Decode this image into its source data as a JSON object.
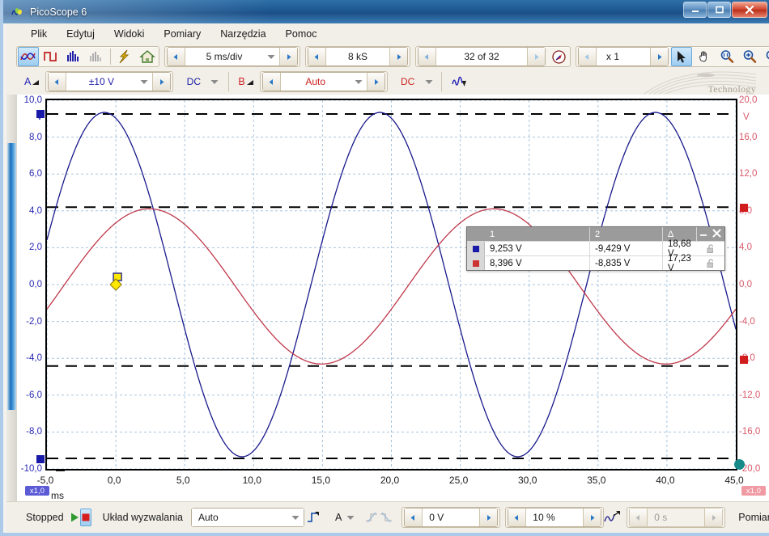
{
  "window": {
    "title": "PicoScope 6",
    "controls": {
      "minimize": "–",
      "maximize": "❐",
      "close": "✕"
    }
  },
  "menu": {
    "items": [
      {
        "label": "Plik"
      },
      {
        "label": "Edytuj"
      },
      {
        "label": "Widoki"
      },
      {
        "label": "Pomiary"
      },
      {
        "label": "Narzędzia"
      },
      {
        "label": "Pomoc"
      }
    ]
  },
  "toolbar_main": {
    "mode_icons": [
      {
        "name": "scope-mode-icon",
        "selected": true
      },
      {
        "name": "square-wave-icon",
        "selected": false
      },
      {
        "name": "spectrum-bars-icon",
        "selected": false
      },
      {
        "name": "spectrum-faded-icon",
        "selected": false
      }
    ],
    "action_icons": [
      {
        "name": "signal-generator-icon"
      },
      {
        "name": "home-icon"
      }
    ],
    "timebase": {
      "label": "timebase",
      "value": "5 ms/div"
    },
    "samples": {
      "label": "samples",
      "value": "8 kS"
    },
    "buffer": {
      "label": "buffer-navigator",
      "value": "32 of 32"
    },
    "compass_icon": "compass-icon",
    "zoom_factor": {
      "label": "zoom-factor",
      "value": "x 1"
    },
    "tools": [
      {
        "name": "pointer-tool-icon",
        "selected": true
      },
      {
        "name": "hand-pan-icon",
        "selected": false
      },
      {
        "name": "zoom-selection-icon",
        "selected": false
      },
      {
        "name": "zoom-in-icon",
        "selected": false
      },
      {
        "name": "zoom-out-icon",
        "selected": false
      },
      {
        "name": "undo-zoom-icon",
        "selected": false
      },
      {
        "name": "zoom-100-icon",
        "selected": false
      }
    ]
  },
  "toolbar_channels": {
    "channel_a": {
      "label": "A",
      "range": "±10 V",
      "coupling": "DC",
      "color": "#2a2ab5"
    },
    "channel_b": {
      "label": "B",
      "range": "Auto",
      "coupling": "DC",
      "color": "#cc2222"
    },
    "math_icon": "math-channel-icon"
  },
  "branding": {
    "tagline": "Technology"
  },
  "chart_data": {
    "type": "line",
    "title": "",
    "xlabel": "ms",
    "ylabel": "V",
    "xlim": [
      -5.0,
      45.0
    ],
    "xticks": [
      "-5,0",
      "0,0",
      "5,0",
      "10,0",
      "15,0",
      "20,0",
      "25,0",
      "30,0",
      "35,0",
      "40,0",
      "45,0"
    ],
    "xtick_values": [
      -5,
      0,
      5,
      10,
      15,
      20,
      25,
      30,
      35,
      40,
      45
    ],
    "left_axis": {
      "unit": "V",
      "color": "#2a2ab5",
      "ylim": [
        -10.0,
        10.0
      ],
      "ticks": [
        "10,0",
        "8,0",
        "6,0",
        "4,0",
        "2,0",
        "0,0",
        "-2,0",
        "-4,0",
        "-6,0",
        "-8,0",
        "-10,0"
      ],
      "tick_values": [
        10,
        8,
        6,
        4,
        2,
        0,
        -2,
        -4,
        -6,
        -8,
        -10
      ]
    },
    "right_axis": {
      "unit": "V",
      "color": "#d8596a",
      "ylim": [
        -20.0,
        20.0
      ],
      "ticks": [
        "20,0",
        "16,0",
        "12,0",
        "8,0",
        "4,0",
        "0,0",
        "-4,0",
        "-8,0",
        "-12,0",
        "-16,0",
        "-20,0"
      ],
      "tick_values": [
        20,
        16,
        12,
        8,
        4,
        0,
        -4,
        -8,
        -12,
        -16,
        -20
      ]
    },
    "grid": true,
    "series": [
      {
        "name": "A",
        "color": "#1a1a8c",
        "axis": "left",
        "waveform": "sine",
        "amplitude": 9.34,
        "period_ms": 20.0,
        "phase_deg": 105.0,
        "offset": 0.0
      },
      {
        "name": "B",
        "color": "#c0394b",
        "axis": "right",
        "waveform": "sine",
        "amplitude": 8.42,
        "period_ms": 25.0,
        "phase_deg": 55.0,
        "offset": -0.2
      }
    ],
    "ruler_lines": [
      {
        "name": "a-upper",
        "axis": "left",
        "value": 9.253
      },
      {
        "name": "a-lower",
        "axis": "left",
        "value": -9.429
      },
      {
        "name": "b-upper",
        "axis": "right",
        "value": 8.396
      },
      {
        "name": "b-lower",
        "axis": "right",
        "value": -8.835
      }
    ],
    "trigger_marker": {
      "x_ms": 0.0,
      "y_v": 0.0,
      "color": "#ffe800"
    }
  },
  "measurement_table": {
    "headers": [
      "",
      "1",
      "2",
      "Δ"
    ],
    "rows": [
      {
        "color": "#1a1aa8",
        "ruler1": "9,253 V",
        "ruler2": "-9,429 V",
        "delta": "18,68 V",
        "lock_icon": "unlocked-icon"
      },
      {
        "color": "#cc3333",
        "ruler1": "8,396 V",
        "ruler2": "-8,835 V",
        "delta": "17,23 V",
        "lock_icon": "unlocked-icon"
      }
    ],
    "minimize_icon": "minimize-icon",
    "close_icon": "close-icon"
  },
  "axis_badges": {
    "left_zoom": "x1,0",
    "right_zoom": "x1,0"
  },
  "status_bar": {
    "state": "Stopped",
    "play_icon": "play-icon",
    "stop_icon": "stop-icon",
    "trigger_label": "Układ wyzwalania",
    "trigger_mode": "Auto",
    "trigger_edge_icon": "rising-edge-icon",
    "trigger_source": "A",
    "edge_rising_icon": "trigger-rising-icon",
    "edge_falling_icon": "trigger-falling-icon",
    "trigger_level": "0 V",
    "pretrigger": "10 %",
    "advanced_trigger_icon": "advanced-trigger-icon",
    "trigger_delay": "0 s",
    "measurements_label": "Pomiary"
  }
}
